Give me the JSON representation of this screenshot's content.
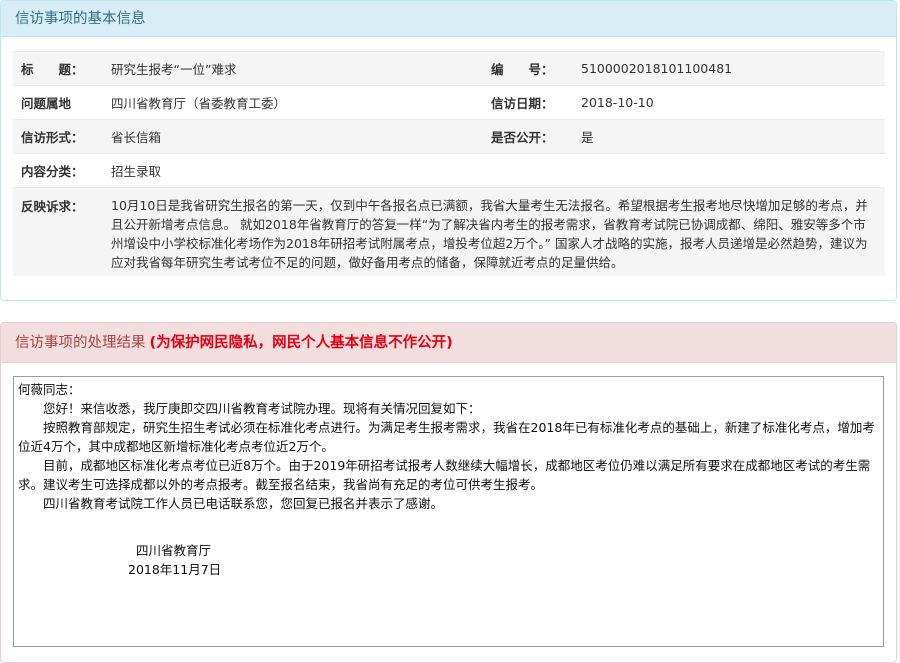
{
  "basic": {
    "title": "信访事项的基本信息",
    "rows": [
      {
        "label": "标　　题：",
        "value": "研究生报考“一位”难求",
        "label2": "编　　号：",
        "value2": "510000201810110048​1"
      },
      {
        "label": "问题属地",
        "value": "四川省教育厅（省委教育工委）",
        "label2": "信访日期：",
        "value2": "2018-10-10"
      },
      {
        "label": "信访形式：",
        "value": "省长信箱",
        "label2": "是否公开：",
        "value2": "是"
      },
      {
        "label": "内容分类：",
        "value": "招生录取"
      }
    ],
    "content_label": "反映诉求：",
    "content": "10月10日是我省研究生报名的第一天，仅到中午各报名点已满额，我省大量考生无法报名。希望根据考生报考地尽快增加足够的考点，并且公开新增考点信息。 就如2018年省教育厅的答复一样“为了解决省内考生的报考需求，省教育考试院已协调成都、绵阳、雅安等多个市州增设中小学校标准化考场作为2018年研招考试附属考点，增投考位超2万个。” 国家人才战略的实施，报考人员递增是必然趋势，建议为应对我省每年研究生考试考位不足的问题，做好备用考点的储备，保障就近考点的足量供给。"
  },
  "result": {
    "title": "信访事项的处理结果",
    "note": "(为保护网民隐私，网民个人基本信息不作公开)",
    "greeting": "何薇同志：",
    "paragraphs": [
      "您好！来信收悉，我厅庚即交四川省教育考试院办理。现将有关情况回复如下：",
      "按照教育部规定，研究生招生考试必须在标准化考点进行。为满足考生报考需求，我省在2018年已有标准化考点的基础上，新建了标准化考点，增加考位近4万个，其中成都地区新增标准化考点考位近2万个。",
      "目前，成都地区标准化考点考位已近8万个。由于2019年研招考试报考人数继续大幅增长，成都地区考位仍难以满足所有要求在成都地区考试的考生需求。建议考生可选择成都以外的考点报考。截至报名结束，我省尚有充足的考位可供考生报考。",
      "四川省教育考试院工作人员已电话联系您，您回复已报名并表示了感谢。"
    ],
    "signature": "四川省教育厅",
    "date": "2018年11月7日"
  }
}
